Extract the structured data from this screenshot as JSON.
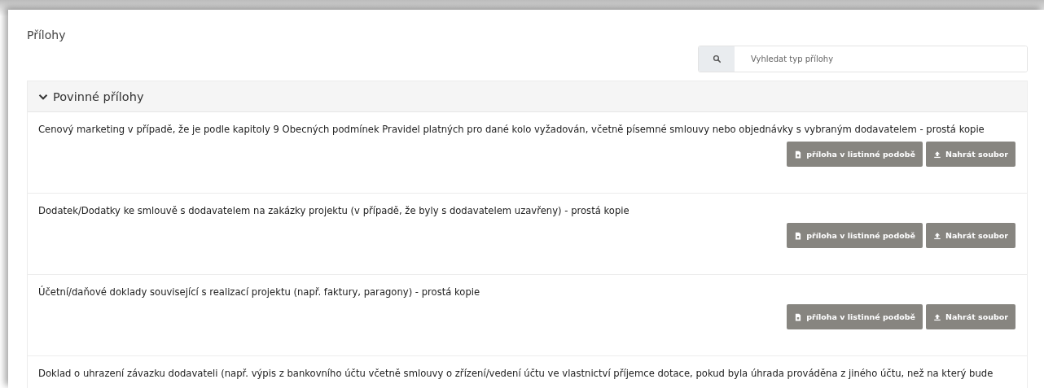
{
  "title": "Přílohy",
  "search": {
    "placeholder": "Vyhledat typ přílohy"
  },
  "section": {
    "title": "Povinné přílohy",
    "expanded": true,
    "items": [
      {
        "text": "Cenový marketing v případě, že je podle kapitoly 9 Obecných podmínek Pravidel platných pro dané kolo vyžadován, včetně písemné smlouvy nebo objednávky s vybraným dodavatelem - prostá kopie",
        "buttons": [
          {
            "kind": "paper",
            "label": "příloha v listinné podobě"
          },
          {
            "kind": "upload",
            "label": "Nahrát soubor"
          }
        ]
      },
      {
        "text": "Dodatek/Dodatky ke smlouvě s dodavatelem na zakázky projektu (v případě, že byly s dodavatelem uzavřeny) - prostá kopie",
        "buttons": [
          {
            "kind": "paper",
            "label": "příloha v listinné podobě"
          },
          {
            "kind": "upload",
            "label": "Nahrát soubor"
          }
        ]
      },
      {
        "text": "Účetní/daňové doklady související s realizací projektu (např. faktury, paragony) - prostá kopie",
        "buttons": [
          {
            "kind": "paper",
            "label": "příloha v listinné podobě"
          },
          {
            "kind": "upload",
            "label": "Nahrát soubor"
          }
        ]
      },
      {
        "text": "Doklad o uhrazení závazku dodavateli (např. výpis z bankovního účtu včetně smlouvy o zřízení/vedení účtu ve vlastnictví příjemce dotace, pokud byla úhrada prováděna z jiného účtu, než na který bude"
      }
    ]
  }
}
